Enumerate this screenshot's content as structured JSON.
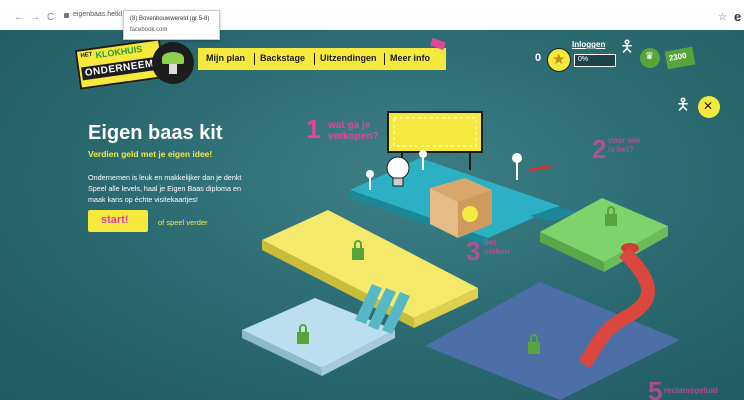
{
  "browser": {
    "back": "←",
    "forward": "→",
    "reload": "C",
    "url": "eigenbaas.hetkl",
    "tooltip_title": "(8) Bovenbouwwereld (gr 5-8)",
    "tooltip_domain": "facebook.com",
    "bookmark_star": "☆",
    "profile": "e"
  },
  "logo": {
    "small": "HET",
    "name": "KLOKHUIS",
    "bottom": "ONDERNEEMT"
  },
  "menu": {
    "items": [
      "Mijn plan",
      "Backstage",
      "Uitzendingen",
      "Meer info"
    ]
  },
  "hud": {
    "score": "0",
    "login": "Inloggen",
    "progress_label": "0%",
    "progress_value": 0,
    "coins": "2300"
  },
  "intro": {
    "title": "Eigen baas kit",
    "subtitle": "Verdien geld met je eigen idee!",
    "desc_lines": [
      "Ondernemen is leuk en makkelijker dan je denkt",
      "Speel alle levels, haal je Eigen Baas diploma en",
      "maak kans op échte visitekaartjes!"
    ],
    "start_label": "start!",
    "play_on": "of speel verder"
  },
  "steps": [
    {
      "number": "1",
      "label_lines": [
        "wat ga je",
        "verkopen?"
      ]
    },
    {
      "number": "2",
      "label_lines": [
        "voor wie",
        "is het?"
      ]
    },
    {
      "number": "3",
      "label_lines": [
        "het",
        "maken"
      ]
    },
    {
      "number": "5",
      "label_lines": [
        "reclamegeluid"
      ]
    }
  ],
  "colors": {
    "brand_yellow": "#f5e93e",
    "brand_pink": "#e2459a",
    "brand_green": "#55a53b",
    "background_teal": "#2a6870"
  }
}
